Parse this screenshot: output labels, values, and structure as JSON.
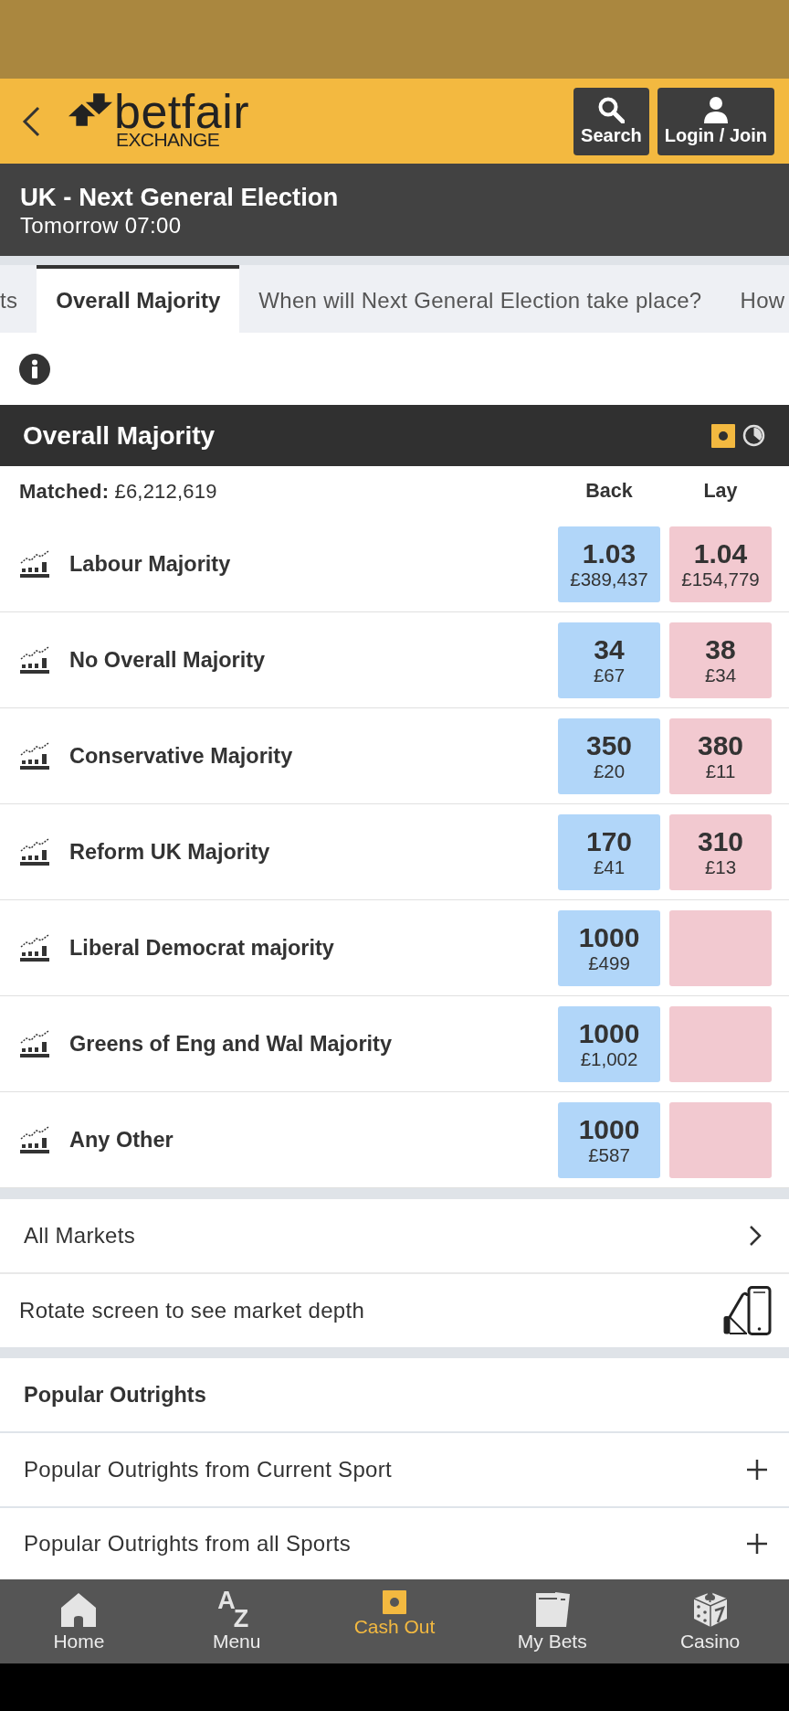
{
  "header": {
    "logo": {
      "wordmark": "betfair",
      "subtitle": "EXCHANGE"
    },
    "buttons": [
      {
        "kind": "search",
        "label": "Search"
      },
      {
        "kind": "user",
        "label": "Login / Join"
      }
    ]
  },
  "event": {
    "title": "UK - Next General Election",
    "time": "Tomorrow 07:00"
  },
  "tabs": [
    {
      "label": "ts",
      "selected": false
    },
    {
      "label": "Overall Majority",
      "selected": true
    },
    {
      "label": "When will Next General Election take place?",
      "selected": false
    },
    {
      "label": "How",
      "selected": false
    }
  ],
  "market": {
    "title": "Overall Majority",
    "matched": "**Matched:** £6,212,619",
    "back_label": "Back",
    "lay_label": "Lay",
    "runners": [
      {
        "name": "Labour Majority",
        "back": {
          "price": "1.03",
          "size": "£389,437"
        },
        "lay": {
          "price": "1.04",
          "size": "£154,779"
        }
      },
      {
        "name": "No Overall Majority",
        "back": {
          "price": "34",
          "size": "£67"
        },
        "lay": {
          "price": "38",
          "size": "£34"
        }
      },
      {
        "name": "Conservative Majority",
        "back": {
          "price": "350",
          "size": "£20"
        },
        "lay": {
          "price": "380",
          "size": "£11"
        }
      },
      {
        "name": "Reform UK Majority",
        "back": {
          "price": "170",
          "size": "£41"
        },
        "lay": {
          "price": "310",
          "size": "£13"
        }
      },
      {
        "name": "Liberal Democrat majority",
        "back": {
          "price": "1000",
          "size": "£499"
        }
      },
      {
        "name": "Greens of Eng and Wal Majority",
        "back": {
          "price": "1000",
          "size": "£1,002"
        }
      },
      {
        "name": "Any Other",
        "back": {
          "price": "1000",
          "size": "£587"
        }
      }
    ]
  },
  "all_markets": {
    "label": "All Markets"
  },
  "rotate_hint": "Rotate screen to see market depth",
  "popular": {
    "title": "Popular Outrights",
    "items": [
      {
        "label": "Popular Outrights from Current Sport",
        "expanded": false
      },
      {
        "label": "Popular Outrights from all Sports",
        "expanded": false
      }
    ]
  },
  "nav": [
    {
      "kind": "home",
      "label": "Home",
      "selected": false
    },
    {
      "kind": "az",
      "label": "Menu",
      "glyphs": [
        "A",
        "Z"
      ],
      "selected": false
    },
    {
      "kind": "cashout",
      "label": "Cash Out",
      "selected": true
    },
    {
      "kind": "bets",
      "label": "My Bets",
      "selected": false
    },
    {
      "kind": "casino",
      "label": "Casino",
      "selected": false
    }
  ]
}
